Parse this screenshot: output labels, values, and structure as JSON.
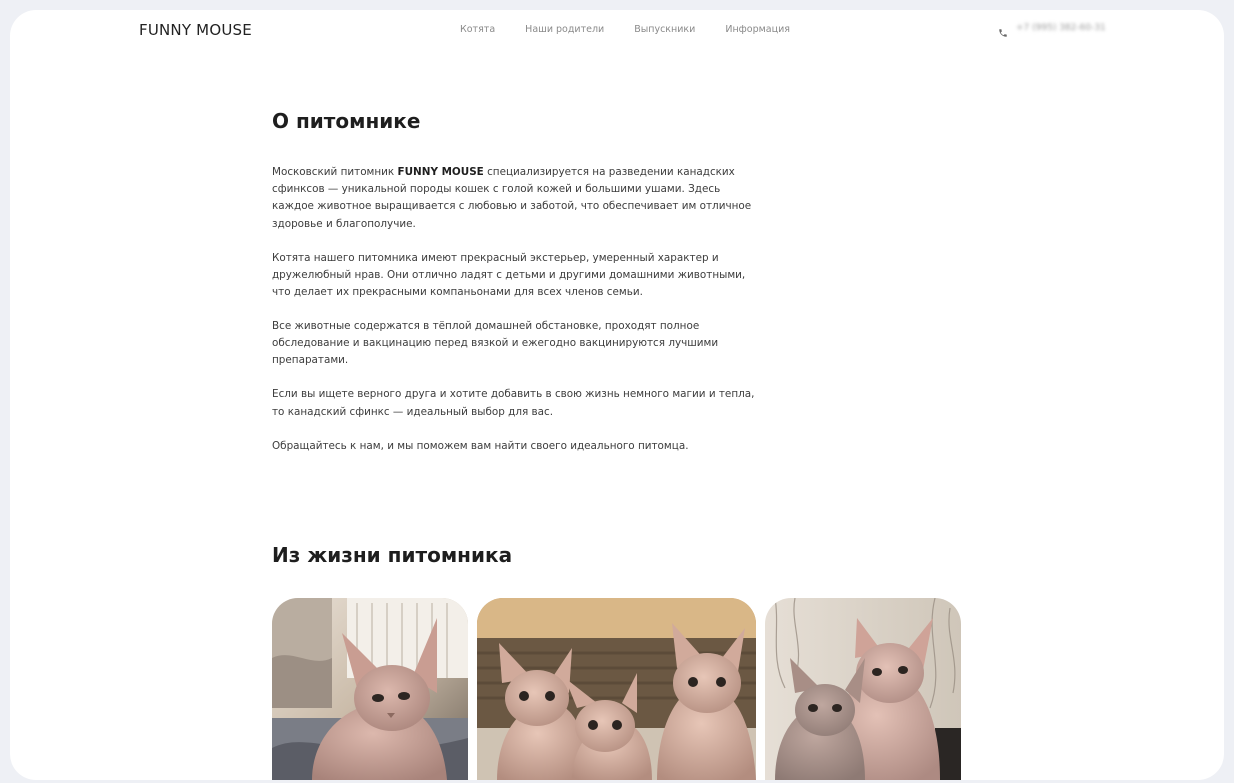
{
  "header": {
    "logo": "FUNNY MOUSE",
    "nav": [
      {
        "label": "Котята"
      },
      {
        "label": "Наши родители"
      },
      {
        "label": "Выпускники"
      },
      {
        "label": "Информация"
      }
    ],
    "phone": "+7 (995) 382-60-31",
    "phone_icon": "phone-icon"
  },
  "about": {
    "title": "О питомнике",
    "p1_before": "Московский питомник ",
    "p1_brand": "FUNNY MOUSE",
    "p1_after": " специализируется на разведении канадских сфинксов — уникальной породы кошек с голой кожей и большими ушами. Здесь каждое животное выращивается с любовью и заботой, что обеспечивает им отличное здоровье и благополучие.",
    "p2": "Котята нашего питомника имеют прекрасный экстерьер, умеренный характер и дружелюбный нрав. Они отлично ладят с детьми и другими домашними животными, что делает их прекрасными компаньонами для всех членов семьи.",
    "p3": "Все животные содержатся в тёплой домашней обстановке, проходят полное обследование и вакцинацию перед вязкой и ежегодно вакцинируются лучшими препаратами.",
    "p4": "Если вы ищете верного друга и хотите добавить в свою жизнь немного магии и тепла, то канадский сфинкс — идеальный выбор для вас.",
    "p5": "Обращайтесь к нам, и мы поможем вам найти своего идеального питомца."
  },
  "life": {
    "title": "Из жизни питомника",
    "photos": [
      "sphynx-kitten-photo",
      "three-sphynx-kittens-photo",
      "two-sphynx-cats-photo"
    ]
  },
  "colors": {
    "page_background": "#eef0f5",
    "card_background": "#ffffff",
    "heading": "#1e1e1e",
    "body_text": "#3c3c3c",
    "nav_text": "#8a8a8a"
  }
}
